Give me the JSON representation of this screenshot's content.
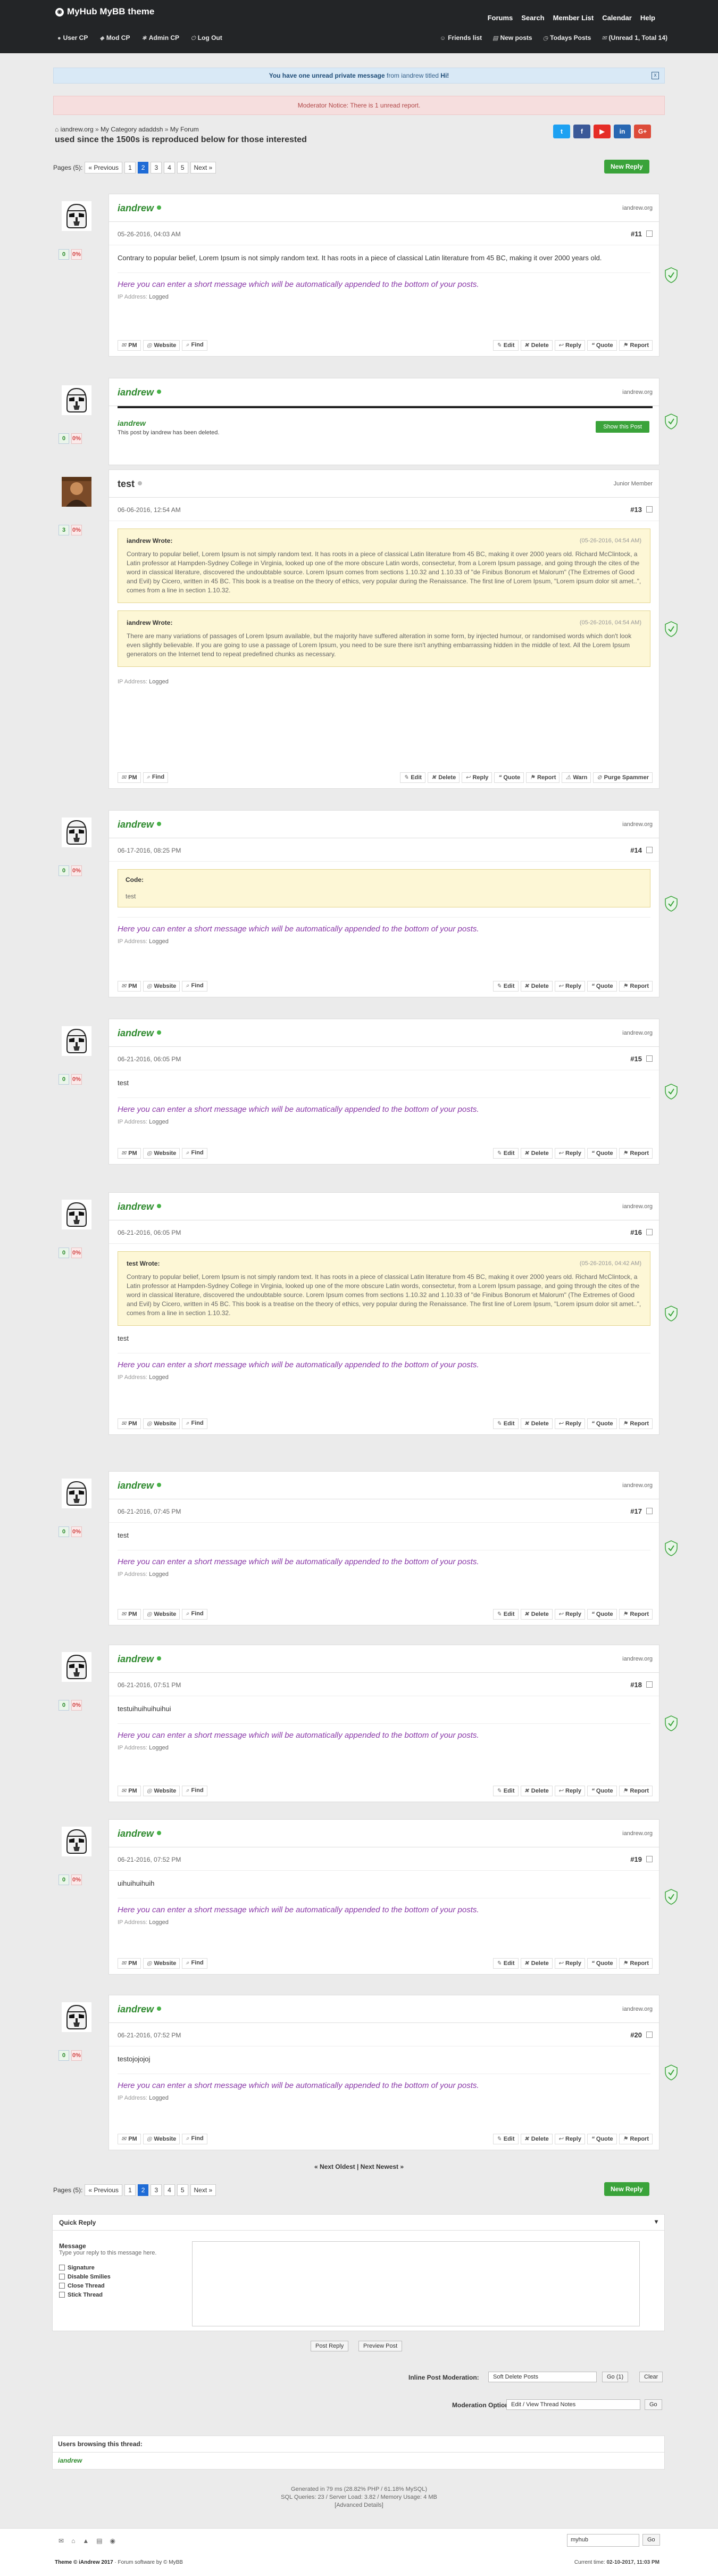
{
  "header": {
    "logo": "MyHub MyBB theme",
    "menu": [
      "Forums",
      "Search",
      "Member List",
      "Calendar",
      "Help"
    ],
    "usermenu": [
      "User CP",
      "Mod CP",
      "Admin CP",
      "Log Out"
    ],
    "rightmenu": [
      "Friends list",
      "New posts",
      "Todays Posts",
      "(Unread 1, Total 14)"
    ]
  },
  "notices": {
    "pm_pre": "You have one unread private message",
    "pm_from": " from iandrew titled ",
    "pm_title": "Hi!",
    "pm_close": "x",
    "mod": "Moderator Notice: There is 1 unread report."
  },
  "breadcrumb": [
    "iandrew.org",
    "My Category adaddsh",
    "My Forum"
  ],
  "thread_title": "used since the 1500s is reproduced below for those interested",
  "share": [
    {
      "label": "t",
      "color": "#1da1f2"
    },
    {
      "label": "f",
      "color": "#3b5998"
    },
    {
      "label": "▶",
      "color": "#e52d27"
    },
    {
      "label": "in",
      "color": "#2867b2"
    },
    {
      "label": "G+",
      "color": "#dd4b39"
    }
  ],
  "pager": {
    "label": "Pages (5):",
    "prev": "« Previous",
    "pages": [
      "1",
      "2",
      "3",
      "4",
      "5"
    ],
    "current": "2",
    "next": "Next »"
  },
  "new_reply": "New Reply",
  "actions_left": [
    "PM",
    "Website",
    "Find"
  ],
  "actions_left_nosite": [
    "PM",
    "Find"
  ],
  "actions_right": [
    "Edit",
    "Delete",
    "Reply",
    "Quote",
    "Report"
  ],
  "actions_right_extra": [
    "Edit",
    "Delete",
    "Reply",
    "Quote",
    "Report",
    "Warn",
    "Purge Spammer"
  ],
  "ip_label": "IP Address:",
  "ip_value": "Logged",
  "signature": "Here you can enter a short message which will be automatically appended to the bottom of your posts.",
  "posts": [
    {
      "user": "iandrew",
      "site": "iandrew.org",
      "rep": "0",
      "warn": "0%",
      "date": "05-26-2016, 04:03 AM",
      "num": "#11",
      "text": "Contrary to popular belief, Lorem Ipsum is not simply random text. It has roots in a piece of classical Latin literature from 45 BC, making it over 2000 years old."
    },
    {
      "user": "iandrew",
      "site": "iandrew.org",
      "rep": "0",
      "warn": "0%",
      "deleted_user": "iandrew",
      "deleted_text": "This post by iandrew has been deleted.",
      "show": "Show this Post"
    },
    {
      "user": "test",
      "title": "Junior Member",
      "rep": "3",
      "warn": "0%",
      "date": "06-06-2016, 12:54 AM",
      "num": "#13",
      "quotes": [
        {
          "who": "iandrew Wrote:",
          "when": "(05-26-2016, 04:54 AM)",
          "text": "Contrary to popular belief, Lorem Ipsum is not simply random text. It has roots in a piece of classical Latin literature from 45 BC, making it over 2000 years old. Richard McClintock, a Latin professor at Hampden-Sydney College in Virginia, looked up one of the more obscure Latin words, consectetur, from a Lorem Ipsum passage, and going through the cites of the word in classical literature, discovered the undoubtable source. Lorem Ipsum comes from sections 1.10.32 and 1.10.33 of \"de Finibus Bonorum et Malorum\" (The Extremes of Good and Evil) by Cicero, written in 45 BC. This book is a treatise on the theory of ethics, very popular during the Renaissance. The first line of Lorem Ipsum, \"Lorem ipsum dolor sit amet..\", comes from a line in section 1.10.32."
        },
        {
          "who": "iandrew Wrote:",
          "when": "(05-26-2016, 04:54 AM)",
          "text": "There are many variations of passages of Lorem Ipsum available, but the majority have suffered alteration in some form, by injected humour, or randomised words which don't look even slightly believable. If you are going to use a passage of Lorem Ipsum, you need to be sure there isn't anything embarrassing hidden in the middle of text. All the Lorem Ipsum generators on the Internet tend to repeat predefined chunks as necessary."
        }
      ]
    },
    {
      "user": "iandrew",
      "site": "iandrew.org",
      "rep": "0",
      "warn": "0%",
      "date": "06-17-2016, 08:25 PM",
      "num": "#14",
      "code_label": "Code:",
      "code": "test"
    },
    {
      "user": "iandrew",
      "site": "iandrew.org",
      "rep": "0",
      "warn": "0%",
      "date": "06-21-2016, 06:05 PM",
      "num": "#15",
      "text": "test"
    },
    {
      "user": "iandrew",
      "site": "iandrew.org",
      "rep": "0",
      "warn": "0%",
      "date": "06-21-2016, 06:05 PM",
      "num": "#16",
      "text": "test",
      "quotes": [
        {
          "who": "test Wrote:",
          "when": "(05-26-2016, 04:42 AM)",
          "text": "Contrary to popular belief, Lorem Ipsum is not simply random text. It has roots in a piece of classical Latin literature from 45 BC, making it over 2000 years old. Richard McClintock, a Latin professor at Hampden-Sydney College in Virginia, looked up one of the more obscure Latin words, consectetur, from a Lorem Ipsum passage, and going through the cites of the word in classical literature, discovered the undoubtable source. Lorem Ipsum comes from sections 1.10.32 and 1.10.33 of \"de Finibus Bonorum et Malorum\" (The Extremes of Good and Evil) by Cicero, written in 45 BC. This book is a treatise on the theory of ethics, very popular during the Renaissance. The first line of Lorem Ipsum, \"Lorem ipsum dolor sit amet..\", comes from a line in section 1.10.32."
        }
      ]
    },
    {
      "user": "iandrew",
      "site": "iandrew.org",
      "rep": "0",
      "warn": "0%",
      "date": "06-21-2016, 07:45 PM",
      "num": "#17",
      "text": "test"
    },
    {
      "user": "iandrew",
      "site": "iandrew.org",
      "rep": "0",
      "warn": "0%",
      "date": "06-21-2016, 07:51 PM",
      "num": "#18",
      "text": "testuihuihuihuihui"
    },
    {
      "user": "iandrew",
      "site": "iandrew.org",
      "rep": "0",
      "warn": "0%",
      "date": "06-21-2016, 07:52 PM",
      "num": "#19",
      "text": "uihuihuihuih"
    },
    {
      "user": "iandrew",
      "site": "iandrew.org",
      "rep": "0",
      "warn": "0%",
      "date": "06-21-2016, 07:52 PM",
      "num": "#20",
      "text": "testojojojoj"
    }
  ],
  "nav_links": "« Next Oldest | Next Newest »",
  "quick_reply": {
    "title": "Quick Reply",
    "toggle": "▾",
    "message_label": "Message",
    "message_sub": "Type your reply to this message here.",
    "options": [
      "Signature",
      "Disable Smilies",
      "Close Thread",
      "Stick Thread"
    ],
    "post_btn": "Post Reply",
    "preview_btn": "Preview Post"
  },
  "inline_mod": {
    "label": "Inline Post Moderation:",
    "value": "Soft Delete Posts",
    "go": "Go (1)",
    "clear": "Clear"
  },
  "mod_options": {
    "label": "Moderation Options:",
    "value": "Edit / View Thread Notes",
    "go": "Go"
  },
  "browsing": {
    "title": "Users browsing this thread:",
    "user": "iandrew"
  },
  "debug": [
    "Generated in 79 ms (28.82% PHP / 61.18% MySQL)",
    "SQL Queries: 23 / Server Load: 3.82 / Memory Usage: 4 MB",
    "[Advanced Details]"
  ],
  "footer": {
    "theme_select": "myhub",
    "go": "Go",
    "copy_label": "Theme © iAndrew 2017",
    "copy_rest": " · Forum software by © MyBB",
    "time_label": "Current time: ",
    "time": "02-10-2017, 11:03 PM"
  },
  "colors": {
    "header": "#232527",
    "online": "#47b347",
    "username": "#2e8a2e",
    "signature": "#8a3aa8",
    "green_button": "#3aa33a",
    "page_current": "#1e6bd6"
  }
}
